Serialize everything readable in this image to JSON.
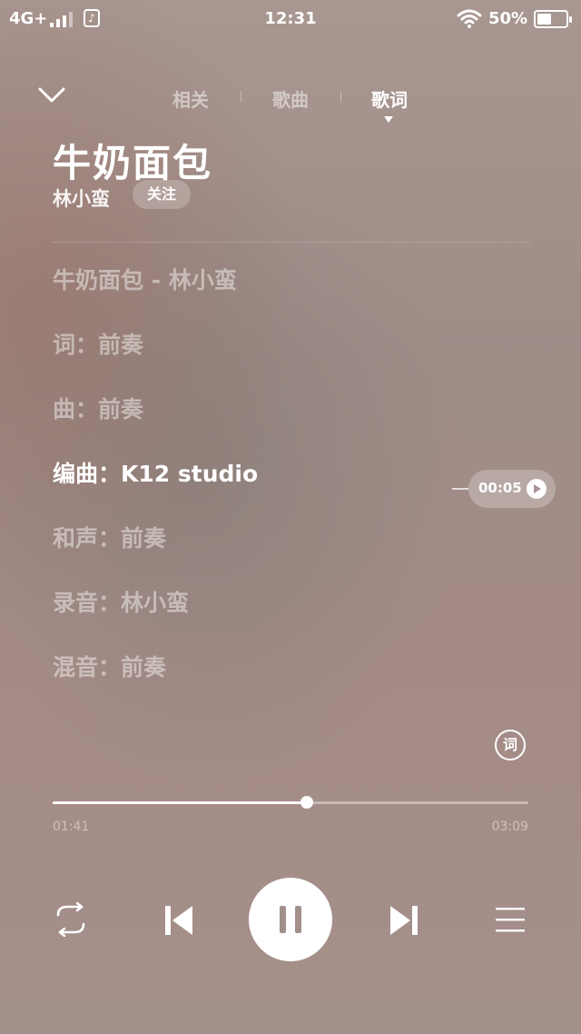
{
  "status_bar": {
    "network": "4G+",
    "music_icon": "music-note-icon",
    "time": "12:31",
    "battery_percent": "50%",
    "battery_level": 0.5
  },
  "nav": {
    "collapse_icon": "chevron-down-icon",
    "tabs": [
      {
        "label": "相关"
      },
      {
        "label": "歌曲"
      },
      {
        "label": "歌词",
        "active": true
      }
    ]
  },
  "song": {
    "title": "牛奶面包",
    "artist": "林小蛮",
    "follow_label": "关注"
  },
  "lyrics": [
    "牛奶面包 - 林小蛮",
    "词：前奏",
    "曲：前奏",
    "编曲：K12 studio",
    "和声：前奏",
    "录音：林小蛮",
    "混音：前奏",
    ""
  ],
  "current_lyric_index": 3,
  "seek_bubble": {
    "time": "00:05",
    "icon": "play-circle-icon"
  },
  "lyric_toggle_label": "词",
  "progress": {
    "elapsed": "01:41",
    "total": "03:09",
    "fraction": 0.535
  },
  "controls": {
    "loop_icon": "repeat-icon",
    "prev_icon": "skip-previous-icon",
    "pause_icon": "pause-icon",
    "next_icon": "skip-next-icon",
    "playlist_icon": "playlist-icon"
  },
  "colors": {
    "accent": "#ffffff"
  }
}
